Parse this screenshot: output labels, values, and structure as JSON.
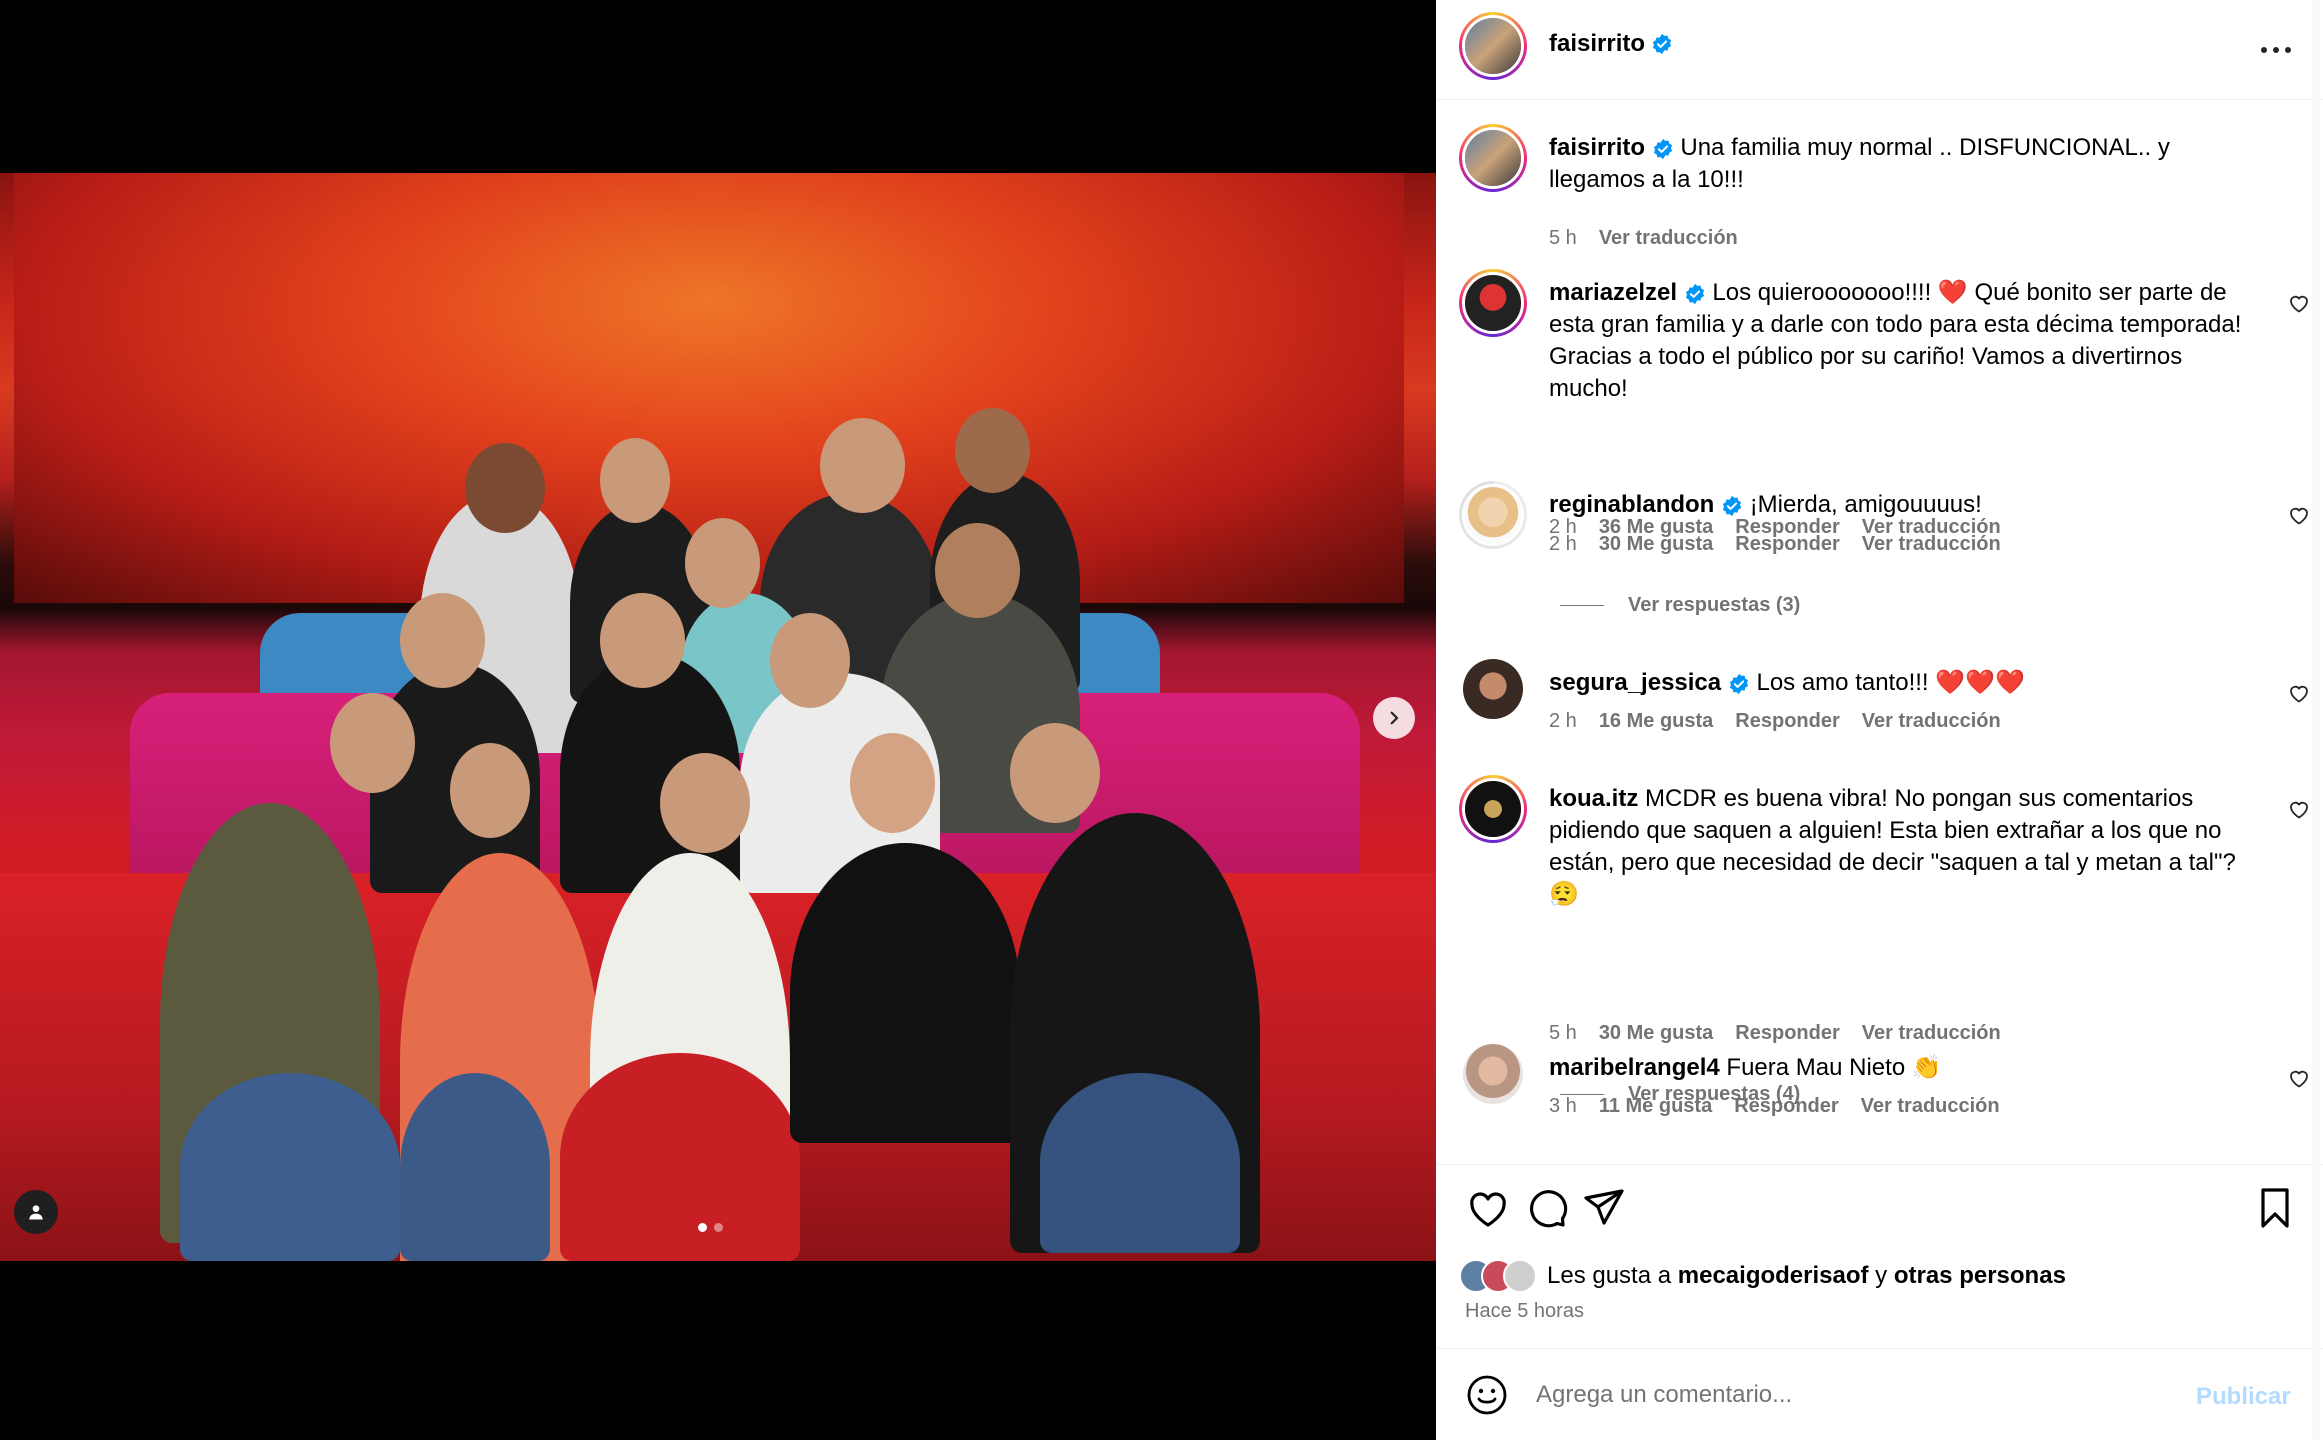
{
  "post": {
    "username": "faisirrito",
    "caption": "Una familia muy normal .. DISFUNCIONAL.. y llegamos a la 10!!!",
    "caption_time": "5 h",
    "caption_translate": "Ver traducción"
  },
  "icons": {
    "verified": "verified-badge-icon",
    "more": "more-options-icon",
    "heart": "heart-icon",
    "comment": "comment-icon",
    "share": "send-icon",
    "save": "bookmark-icon",
    "emoji": "emoji-icon",
    "next": "chevron-right-icon",
    "tag": "user-tag-icon"
  },
  "comments": [
    {
      "username": "mariazelzel",
      "verified": true,
      "text": "Los quierooooooo!!!! ❤️ Qué bonito ser parte de esta gran familia y a darle con todo para esta décima temporada! Gracias a todo el público por su cariño! Vamos a divertirnos mucho!",
      "time": "2 h",
      "likes": "36 Me gusta",
      "reply": "Responder",
      "translate": "Ver traducción"
    },
    {
      "username": "reginablandon",
      "verified": true,
      "text": "¡Mierda, amigouuuus!",
      "time": "2 h",
      "likes": "30 Me gusta",
      "reply": "Responder",
      "translate": "Ver traducción",
      "replies": "Ver respuestas (3)"
    },
    {
      "username": "segura_jessica",
      "verified": true,
      "text": "Los amo tanto!!! ❤️❤️❤️",
      "time": "2 h",
      "likes": "16 Me gusta",
      "reply": "Responder",
      "translate": "Ver traducción"
    },
    {
      "username": "koua.itz",
      "verified": false,
      "text": "MCDR es buena vibra! No pongan sus comentarios pidiendo que saquen a alguien! Esta bien extrañar a los que no están, pero que necesidad de decir \"saquen a tal y metan a tal\"? 😮‍💨",
      "time": "5 h",
      "likes": "30 Me gusta",
      "reply": "Responder",
      "translate": "Ver traducción",
      "replies": "Ver respuestas (4)"
    },
    {
      "username": "maribelrangel4",
      "verified": false,
      "text": "Fuera Mau Nieto 👏",
      "time": "3 h",
      "likes": "11 Me gusta",
      "reply": "Responder",
      "translate": "Ver traducción"
    }
  ],
  "likes": {
    "prefix": "Les gusta a",
    "user": "mecaigoderisaof",
    "suffix": "y",
    "others": "otras personas"
  },
  "posted_ago": "Hace 5 horas",
  "comment_box": {
    "placeholder": "Agrega un comentario...",
    "publish": "Publicar"
  },
  "carousel": {
    "current": 1,
    "total": 2
  },
  "colors": {
    "accent": "#0095f6",
    "publish_disabled": "#b3dbff",
    "muted": "#737373",
    "verified": "#0095f6"
  }
}
